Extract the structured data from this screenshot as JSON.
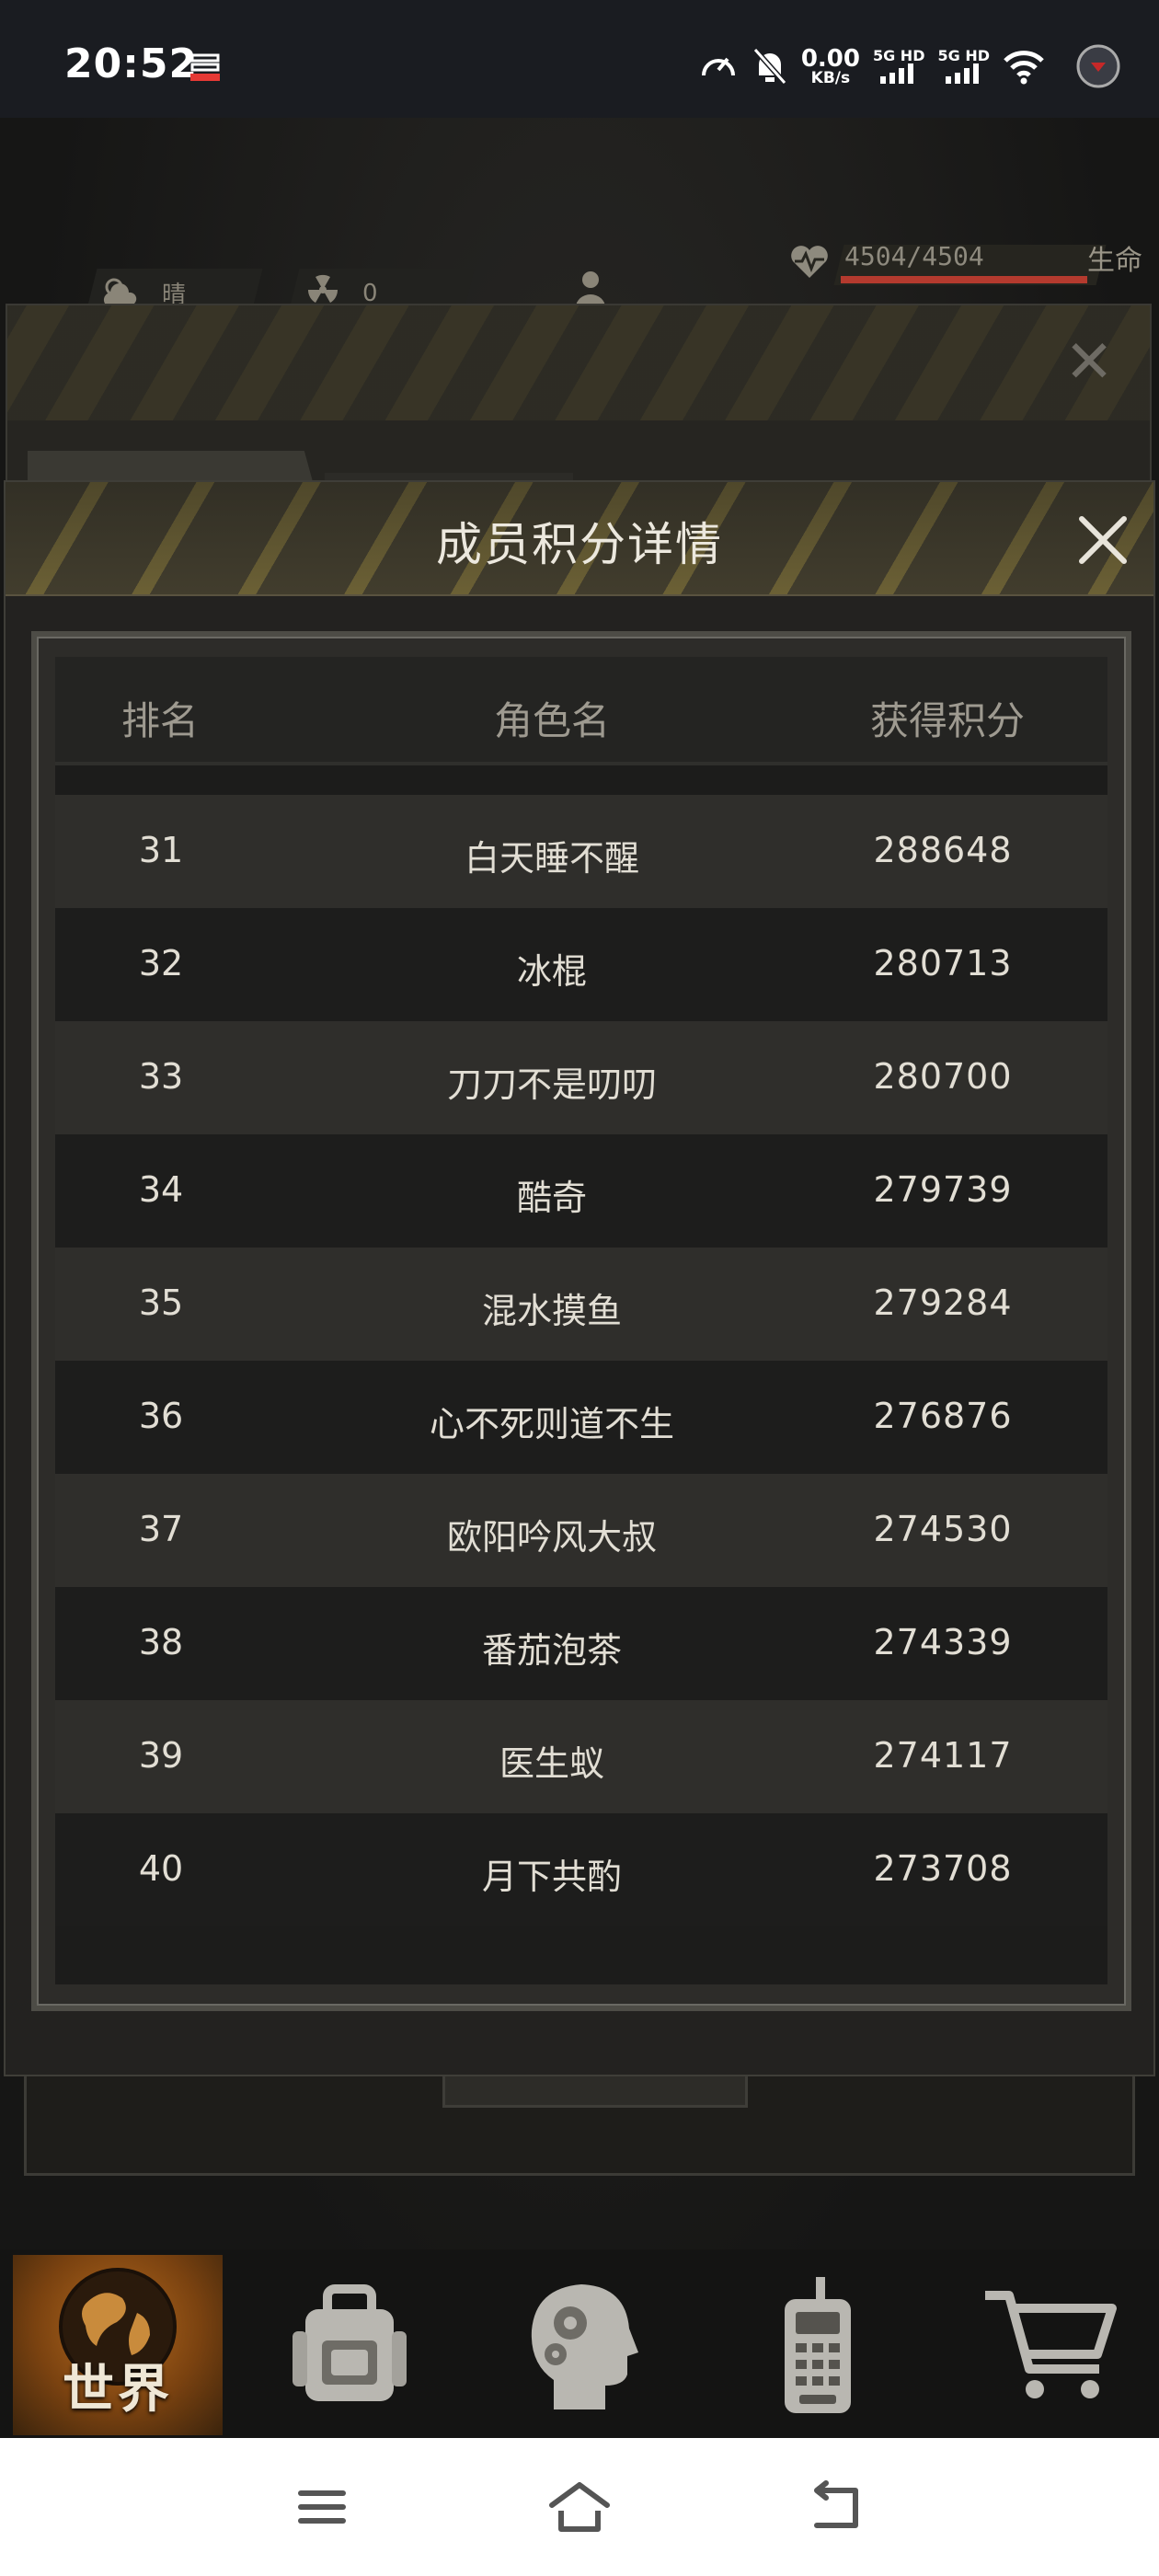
{
  "status_bar": {
    "time": "20:52",
    "net_speed_value": "0.00",
    "net_speed_unit": "KB/s",
    "sim1_label": "5G HD",
    "sim2_label": "5G HD"
  },
  "hud": {
    "weather_label": "晴",
    "radiation_value": "0",
    "hp_value": "4504/4504",
    "hp_label": "生命",
    "hp_fraction": 1.0
  },
  "modal": {
    "title": "成员积分详情",
    "columns": {
      "rank": "排名",
      "name": "角色名",
      "score": "获得积分"
    },
    "rows": [
      {
        "rank": "31",
        "name": "白天睡不醒",
        "score": "288648"
      },
      {
        "rank": "32",
        "name": "冰棍",
        "score": "280713"
      },
      {
        "rank": "33",
        "name": "刀刀不是叨叨",
        "score": "280700"
      },
      {
        "rank": "34",
        "name": "酷奇",
        "score": "279739"
      },
      {
        "rank": "35",
        "name": "混水摸鱼",
        "score": "279284"
      },
      {
        "rank": "36",
        "name": "心不死则道不生",
        "score": "276876"
      },
      {
        "rank": "37",
        "name": "欧阳吟风大叔",
        "score": "274530"
      },
      {
        "rank": "38",
        "name": "番茄泡茶",
        "score": "274339"
      },
      {
        "rank": "39",
        "name": "医生蚁",
        "score": "274117"
      },
      {
        "rank": "40",
        "name": "月下共酌",
        "score": "273708"
      }
    ]
  },
  "game_nav": {
    "world_label": "世界",
    "items": [
      "world-icon",
      "backpack-icon",
      "skills-head-icon",
      "radio-icon",
      "cart-icon"
    ]
  },
  "system_nav": [
    "menu-icon",
    "home-icon",
    "back-icon"
  ],
  "colors": {
    "accent_orange": "#b56a1e",
    "hp_red": "#b43a2e",
    "stripe_yellow": "#8a7a3c"
  }
}
